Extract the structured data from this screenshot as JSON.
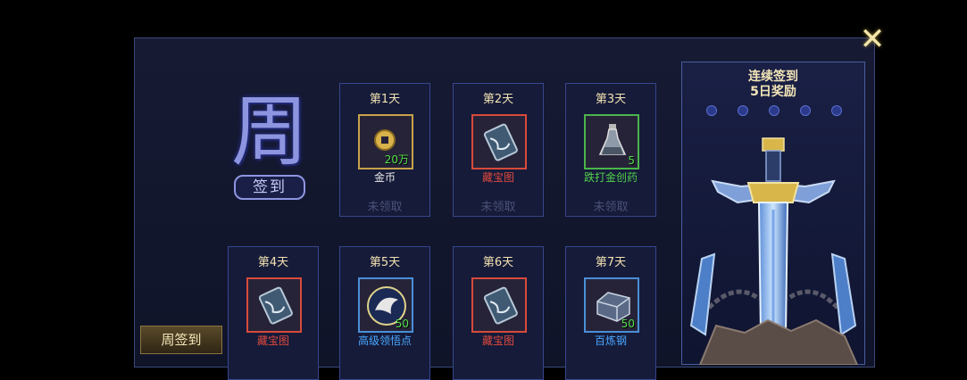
{
  "close_icon": "close-x-icon",
  "emblem": {
    "char": "周",
    "badge": "签到"
  },
  "days": [
    {
      "title": "第1天",
      "item": "金币",
      "qty": "20万",
      "status": "未领取",
      "icon": "coin-icon",
      "frame": "#c8a24a",
      "name_color": "#e8e8e8"
    },
    {
      "title": "第2天",
      "item": "藏宝图",
      "qty": "",
      "status": "未领取",
      "icon": "treasure-map-icon",
      "frame": "#d84a3a",
      "name_color": "#e04a3c"
    },
    {
      "title": "第3天",
      "item": "跌打金创药",
      "qty": "5",
      "status": "未领取",
      "icon": "medicine-bottle-icon",
      "frame": "#4ab54a",
      "name_color": "#52d04a"
    },
    {
      "title": "第4天",
      "item": "藏宝图",
      "qty": "",
      "status": "",
      "icon": "treasure-map-icon",
      "frame": "#d84a3a",
      "name_color": "#e04a3c"
    },
    {
      "title": "第5天",
      "item": "高级领悟点",
      "qty": "50",
      "status": "",
      "icon": "insight-point-icon",
      "frame": "#4a8fd8",
      "name_color": "#4aa8ff"
    },
    {
      "title": "第6天",
      "item": "藏宝图",
      "qty": "",
      "status": "",
      "icon": "treasure-map-icon",
      "frame": "#d84a3a",
      "name_color": "#e04a3c"
    },
    {
      "title": "第7天",
      "item": "百炼钢",
      "qty": "50",
      "status": "",
      "icon": "steel-ingot-icon",
      "frame": "#4a8fd8",
      "name_color": "#4aa8ff"
    }
  ],
  "bonus": {
    "title_line1": "连续签到",
    "title_line2": "5日奖励",
    "progress_dots": 5,
    "reward_icon": "sword-icon"
  },
  "tabs": [
    {
      "label": "周签到",
      "active": true
    }
  ]
}
